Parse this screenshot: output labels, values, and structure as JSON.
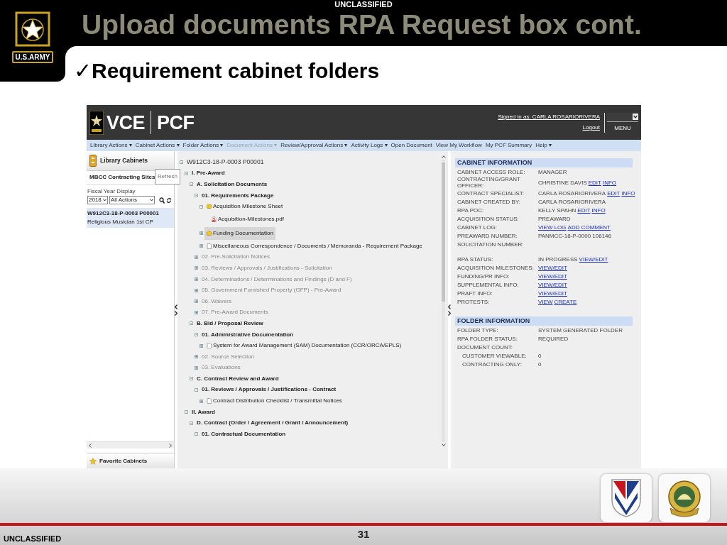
{
  "slide": {
    "classification_top": "UNCLASSIFIED",
    "title": "Upload documents RPA Request box cont.",
    "logo_text": "U.S.ARMY",
    "bullet": {
      "mark": "✓",
      "text": "Requirement cabinet folders"
    },
    "classification_bottom": "UNCLASSIFIED",
    "page_number": "31"
  },
  "app": {
    "brand": "VCE",
    "product": "PCF",
    "signed_in": "Signed in as: CARLA ROSARIORIVERA",
    "logout": "Logout",
    "menu_label": "MENU",
    "menu_bar": [
      {
        "label": "Library Actions ▾",
        "disabled": false
      },
      {
        "label": "Cabinet Actions ▾",
        "disabled": false
      },
      {
        "label": "Folder Actions ▾",
        "disabled": false
      },
      {
        "label": "Document Actions ▾",
        "disabled": true
      },
      {
        "label": "Review/Approval Actions ▾",
        "disabled": false
      },
      {
        "label": "Activity Logs ▾",
        "disabled": false
      },
      {
        "label": "Open Document",
        "disabled": false
      },
      {
        "label": "View My Workflow",
        "disabled": false
      },
      {
        "label": "My PCF Summary",
        "disabled": false
      },
      {
        "label": "Help ▾",
        "disabled": false
      }
    ],
    "left_panel": {
      "title": "Library Cabinets",
      "site": "MBCC Contracting Sites",
      "tooltip": "Refresh",
      "filter_label": "Fiscal Year Display",
      "year": "2018",
      "actions": "All Actions",
      "cabinets": [
        {
          "number": "W912C3-18-P-0003 P00001",
          "description": "Religious Musician 1st CP",
          "selected": true
        }
      ],
      "favorites": "Favorite Cabinets"
    },
    "tree": [
      {
        "label": "W912C3-18-P-0003 P00001",
        "kind": "root",
        "expanded": true,
        "selected": false,
        "children": [
          {
            "label": "I. Pre-Award",
            "kind": "section",
            "expanded": true,
            "selected": false,
            "children": [
              {
                "label": "A. Solicitation Documents",
                "kind": "section",
                "expanded": true,
                "selected": false,
                "children": [
                  {
                    "label": "01. Requirements Package",
                    "kind": "section",
                    "expanded": true,
                    "selected": false,
                    "children": [
                      {
                        "label": "Acquisition Milestone Sheet",
                        "kind": "folder",
                        "expanded": true,
                        "selected": false,
                        "children": [
                          {
                            "label": "Acquisition-Milestones.pdf",
                            "kind": "pdf",
                            "selected": false
                          }
                        ]
                      },
                      {
                        "label": "Funding Documentation",
                        "kind": "folder",
                        "expanded": false,
                        "selected": true
                      },
                      {
                        "label": "Miscellaneous Correspondence / Documents / Memoranda - Requirement Package",
                        "kind": "doc",
                        "expanded": false,
                        "selected": false
                      }
                    ]
                  },
                  {
                    "label": "02. Pre-Solicitation Notices",
                    "kind": "section",
                    "expanded": false,
                    "selected": false
                  },
                  {
                    "label": "03. Reviews / Approvals / Justifications - Solicitation",
                    "kind": "section",
                    "expanded": false,
                    "selected": false
                  },
                  {
                    "label": "04. Determinations / Determinations and Findings (D and F)",
                    "kind": "section",
                    "expanded": false,
                    "selected": false
                  },
                  {
                    "label": "05. Government Furnished Property (GFP) - Pre-Award",
                    "kind": "section",
                    "expanded": false,
                    "selected": false
                  },
                  {
                    "label": "06. Waivers",
                    "kind": "section",
                    "expanded": false,
                    "selected": false
                  },
                  {
                    "label": "07. Pre-Award Documents",
                    "kind": "section",
                    "expanded": false,
                    "selected": false
                  }
                ]
              },
              {
                "label": "B. Bid / Proposal Review",
                "kind": "section",
                "expanded": true,
                "selected": false,
                "children": [
                  {
                    "label": "01. Administrative Documentation",
                    "kind": "section",
                    "expanded": true,
                    "selected": false,
                    "children": [
                      {
                        "label": "System for Award Management (SAM) Documentation (CCR/ORCA/EPLS)",
                        "kind": "doc",
                        "expanded": false,
                        "selected": false
                      }
                    ]
                  },
                  {
                    "label": "02. Source Selection",
                    "kind": "section",
                    "expanded": false,
                    "selected": false
                  },
                  {
                    "label": "03. Evaluations",
                    "kind": "section",
                    "expanded": false,
                    "selected": false
                  }
                ]
              },
              {
                "label": "C. Contract Review and Award",
                "kind": "section",
                "expanded": true,
                "selected": false,
                "children": [
                  {
                    "label": "01. Reviews / Approvals / Justifications - Contract",
                    "kind": "section",
                    "expanded": true,
                    "selected": false,
                    "children": [
                      {
                        "label": "Contract Distribution Checklist / Transmittal Notices",
                        "kind": "doc",
                        "expanded": false,
                        "selected": false
                      }
                    ]
                  }
                ]
              }
            ]
          },
          {
            "label": "II. Award",
            "kind": "section",
            "expanded": true,
            "selected": false,
            "children": [
              {
                "label": "D. Contract (Order / Agreement / Grant / Announcement)",
                "kind": "section",
                "expanded": true,
                "selected": false,
                "children": [
                  {
                    "label": "01. Contractual Documentation",
                    "kind": "section",
                    "expanded": true,
                    "selected": false
                  }
                ]
              }
            ]
          }
        ]
      }
    ],
    "cabinet_information": {
      "title": "CABINET INFORMATION",
      "groups": [
        [
          {
            "label": "CABINET ACCESS ROLE:",
            "value": "MANAGER"
          },
          {
            "label": "CONTRACTING/GRANT OFFICER:",
            "value": "CHRISTINE DAVIS",
            "links": [
              "EDIT",
              "INFO"
            ]
          },
          {
            "label": "CONTRACT SPECIALIST:",
            "value": "CARLA ROSARIORIVERA",
            "links": [
              "EDIT",
              "INFO"
            ]
          },
          {
            "label": "CABINET CREATED BY:",
            "value": "CARLA ROSARIORIVERA"
          },
          {
            "label": "RPA POC:",
            "value": "KELLY SPAHN",
            "links": [
              "EDIT",
              "INFO"
            ]
          },
          {
            "label": "ACQUISITION STATUS:",
            "value": "PREAWARD"
          },
          {
            "label": "CABINET LOG:",
            "links": [
              "VIEW LOG",
              "ADD COMMENT"
            ]
          },
          {
            "label": "PREAWARD NUMBER:",
            "value": "PANMCC-18-P-0000 106146"
          },
          {
            "label": "SOLICITATION NUMBER:"
          }
        ],
        [
          {
            "label": "RPA STATUS:",
            "value": "IN PROGRESS",
            "links": [
              "VIEW/EDIT"
            ]
          },
          {
            "label": "ACQUISITION MILESTONES:",
            "links": [
              "VIEW/EDIT"
            ]
          },
          {
            "label": "FUNDING/PR INFO:",
            "links": [
              "VIEW/EDIT"
            ]
          },
          {
            "label": "SUPPLEMENTAL INFO:",
            "links": [
              "VIEW/EDIT"
            ]
          },
          {
            "label": "PRAFT INFO:",
            "links": [
              "VIEW/EDIT"
            ]
          },
          {
            "label": "PROTESTS:",
            "links": [
              "VIEW",
              "CREATE"
            ]
          }
        ]
      ]
    },
    "folder_information": {
      "title": "FOLDER INFORMATION",
      "groups": [
        [
          {
            "label": "FOLDER TYPE:",
            "value": "SYSTEM GENERATED FOLDER"
          },
          {
            "label": "RPA FOLDER STATUS:",
            "value": "REQUIRED"
          },
          {
            "label": "DOCUMENT COUNT:",
            "children": [
              {
                "label": "CUSTOMER VIEWABLE:",
                "value": "0"
              },
              {
                "label": "CONTRACTING ONLY:",
                "value": "0"
              }
            ]
          }
        ]
      ]
    }
  }
}
